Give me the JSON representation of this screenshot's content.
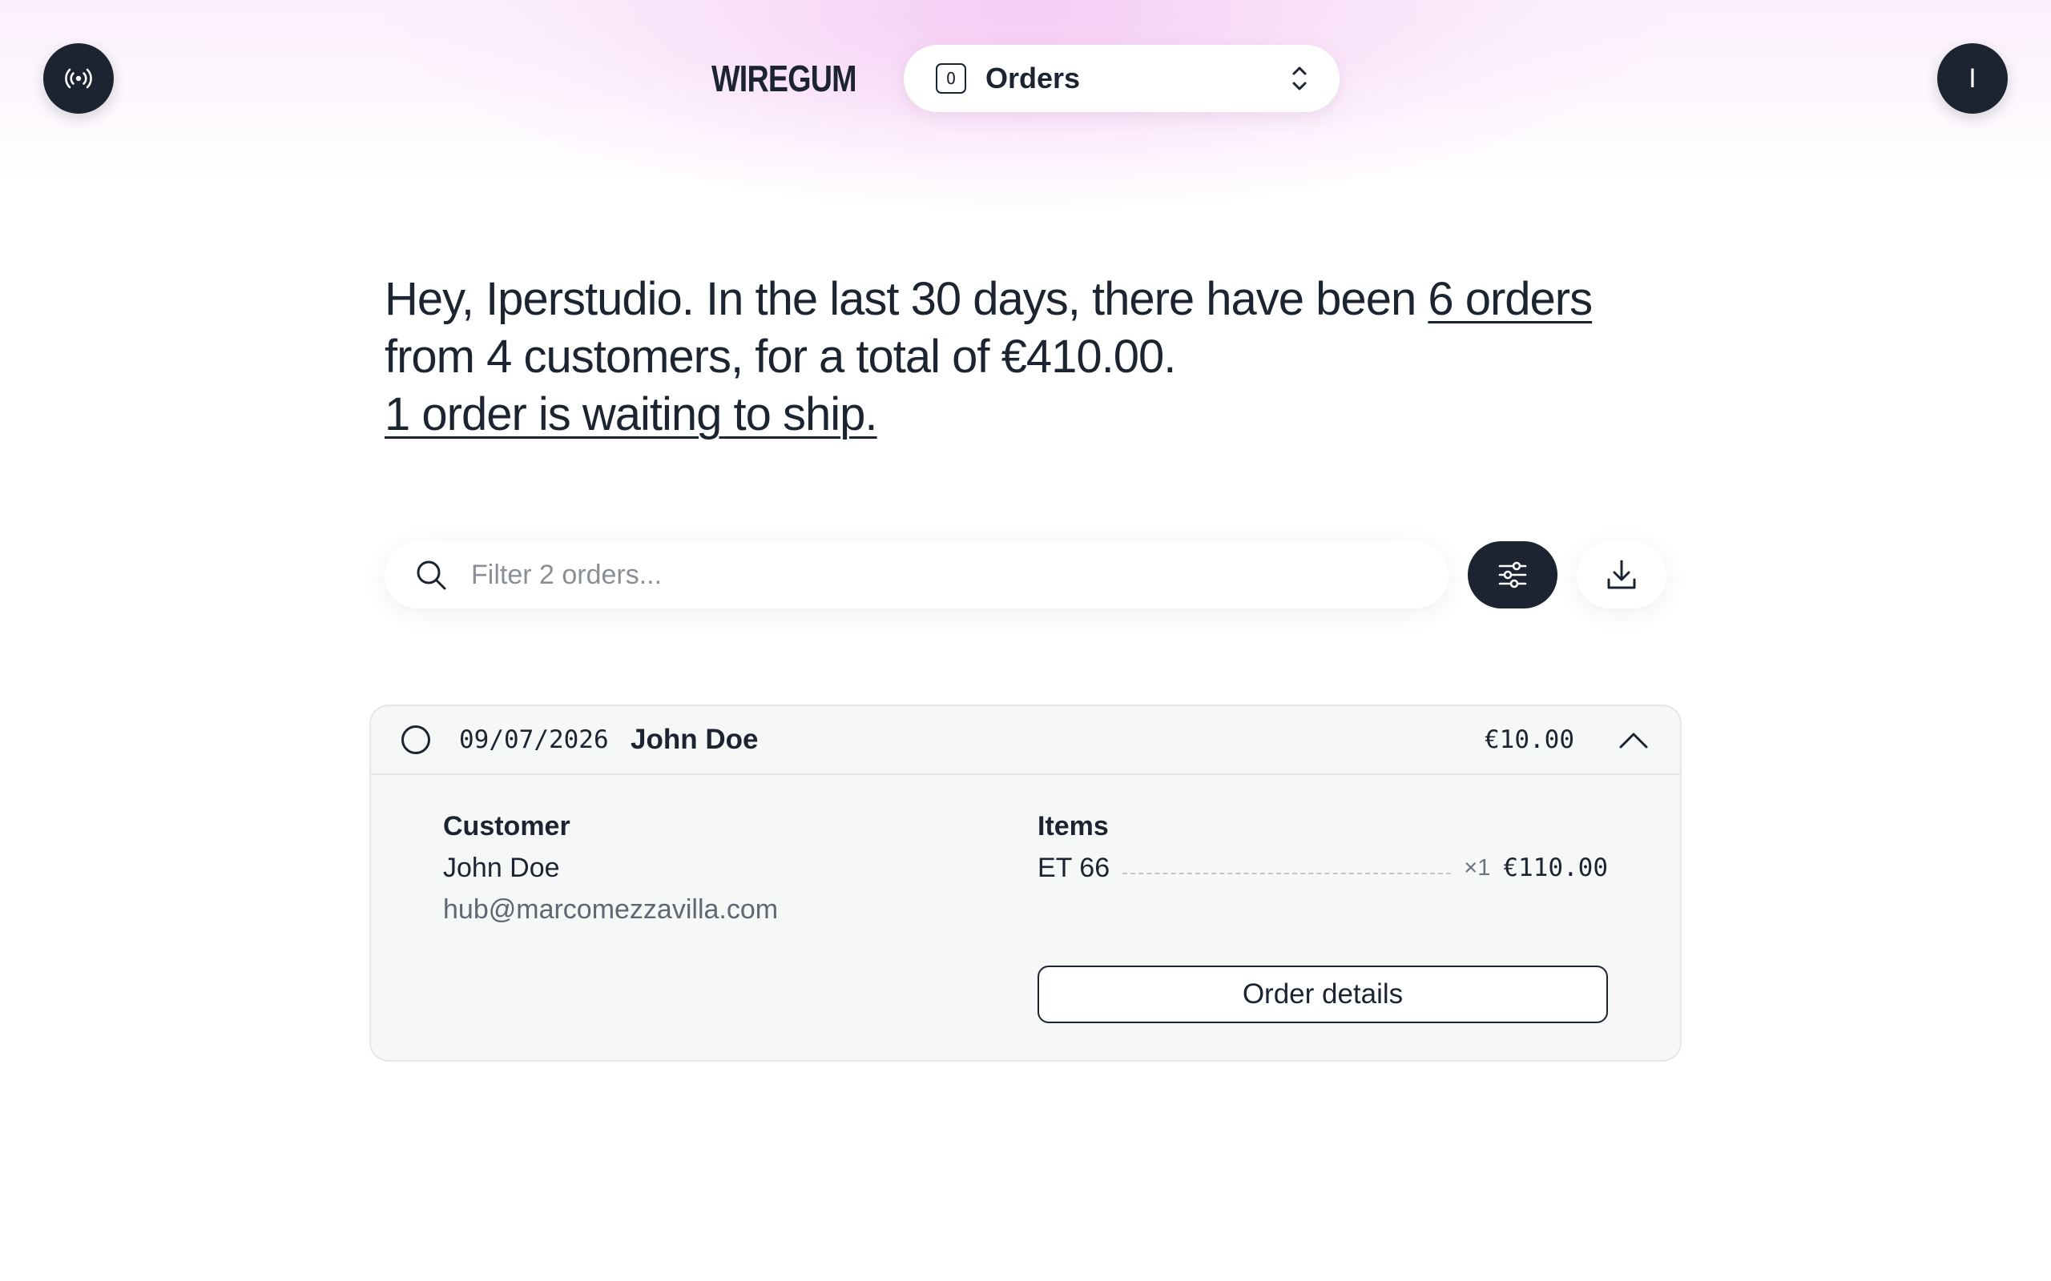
{
  "header": {
    "brand": "WIREGUM",
    "switcher": {
      "shortcut_key": "O",
      "label": "Orders"
    },
    "avatar_initial": "I",
    "icons": {
      "live": "broadcast-icon",
      "switcher_toggle": "chevron-up-down-icon"
    }
  },
  "summary": {
    "prefix": "Hey, Iperstudio. In the last 30 days, there have been ",
    "orders_link": "6 orders",
    "middle": " from 4 customers, for a total of €410.00.",
    "waiting_link": "1 order is waiting to ship."
  },
  "filter": {
    "placeholder": "Filter 2 orders...",
    "value": "",
    "icons": {
      "search": "search-icon",
      "filters": "sliders-icon",
      "download": "download-icon"
    }
  },
  "orders": [
    {
      "date": "09/07/2026",
      "customer": "John Doe",
      "total": "€10.00",
      "expanded": true,
      "details": {
        "customer_title": "Customer",
        "customer_name": "John Doe",
        "customer_email": "hub@marcomezzavilla.com",
        "items_title": "Items",
        "items": [
          {
            "name": "ET 66",
            "quantity": "×1",
            "price": "€110.00"
          }
        ],
        "button_label": "Order details"
      }
    }
  ],
  "colors": {
    "primary": "#1b2430",
    "card_background": "#f6f7f7",
    "glow": "#ee96e8",
    "muted_text": "#5f6772"
  }
}
